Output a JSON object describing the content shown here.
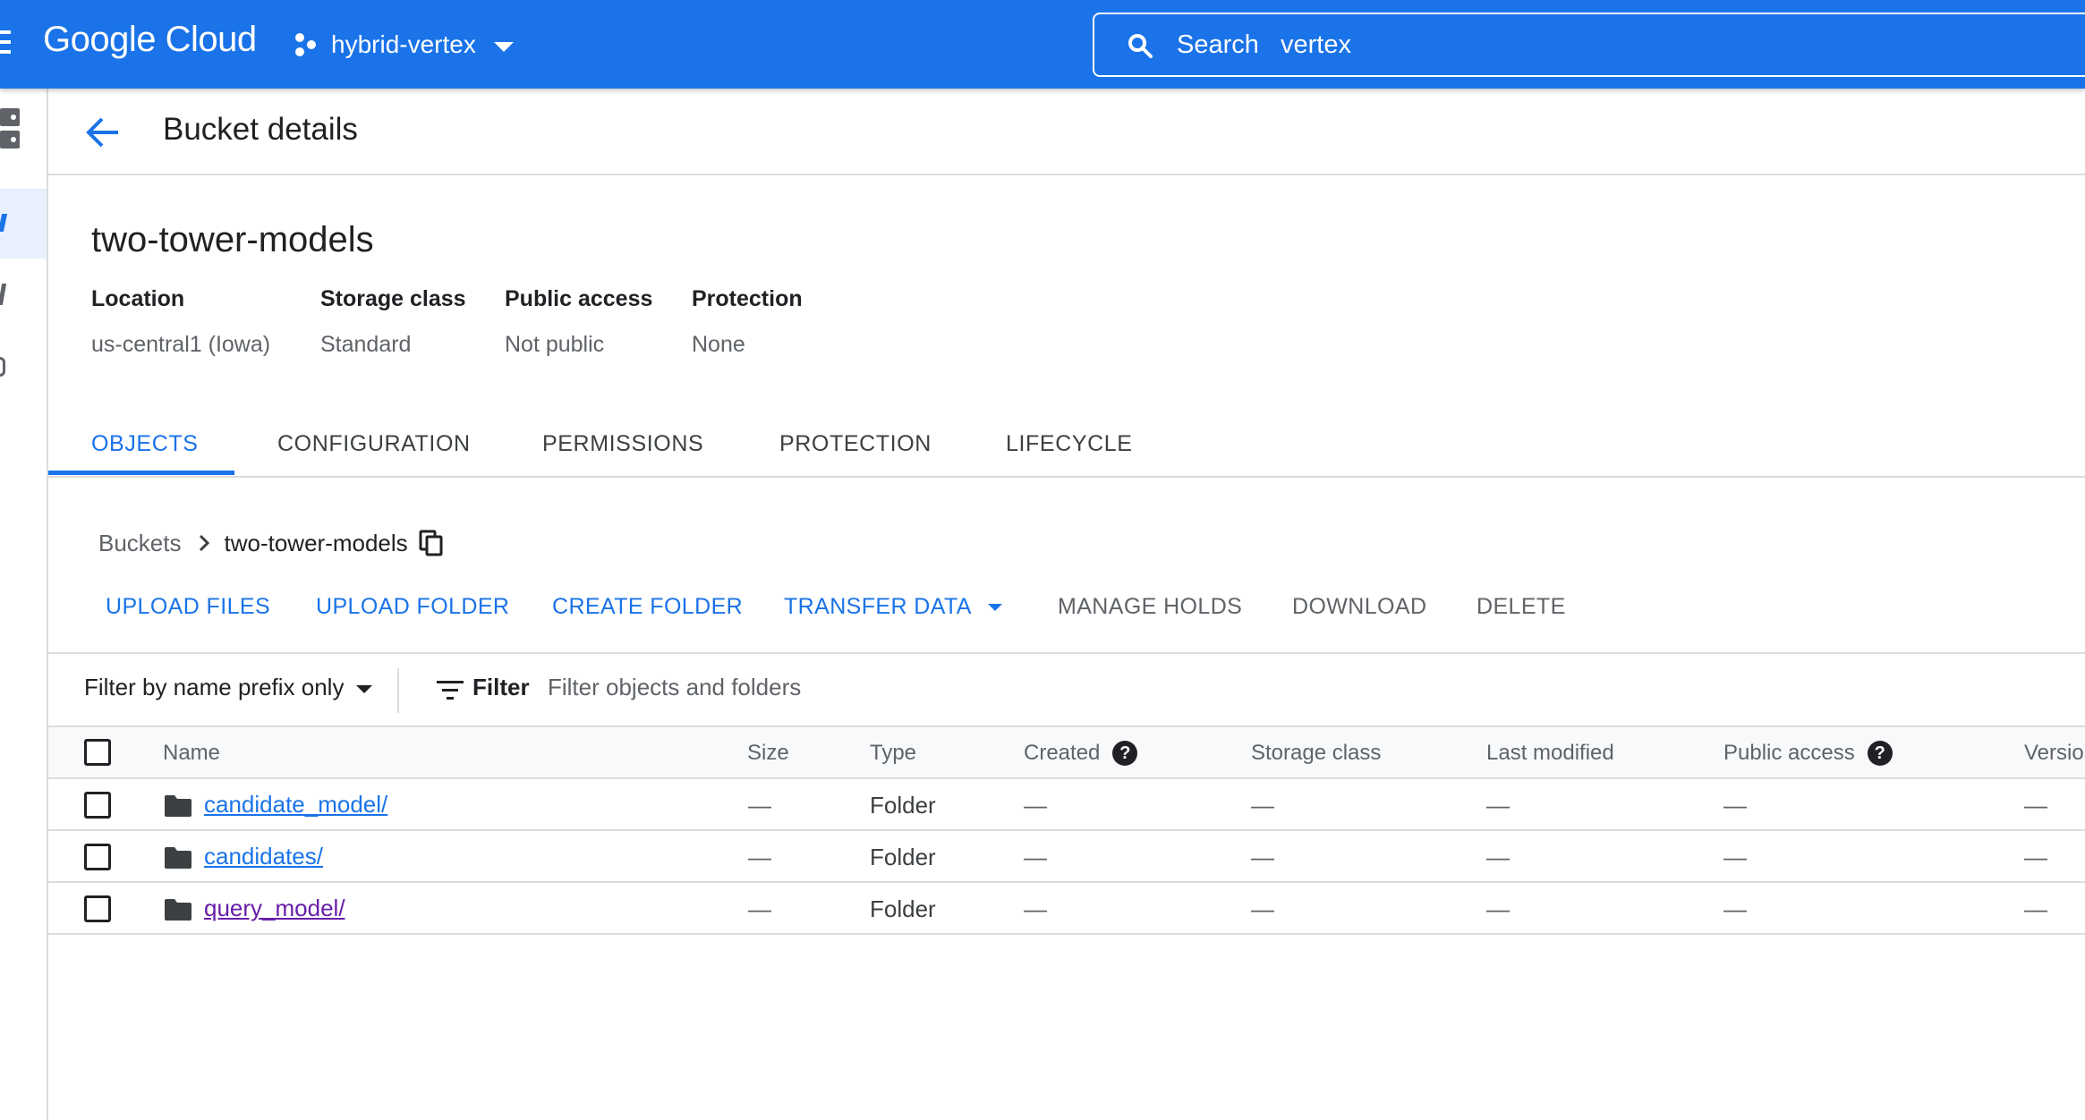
{
  "topbar": {
    "logo": "Google Cloud",
    "project": "hybrid-vertex",
    "search_label": "Search",
    "search_value": "vertex"
  },
  "page": {
    "title": "Bucket details",
    "bucket_name": "two-tower-models"
  },
  "bucket_meta": [
    {
      "label": "Location",
      "value": "us-central1 (Iowa)"
    },
    {
      "label": "Storage class",
      "value": "Standard"
    },
    {
      "label": "Public access",
      "value": "Not public"
    },
    {
      "label": "Protection",
      "value": "None"
    }
  ],
  "tabs": [
    {
      "label": "OBJECTS",
      "active": true
    },
    {
      "label": "CONFIGURATION",
      "active": false
    },
    {
      "label": "PERMISSIONS",
      "active": false
    },
    {
      "label": "PROTECTION",
      "active": false
    },
    {
      "label": "LIFECYCLE",
      "active": false
    }
  ],
  "breadcrumb": {
    "root": "Buckets",
    "current": "two-tower-models"
  },
  "actions": [
    {
      "label": "UPLOAD FILES",
      "enabled": true
    },
    {
      "label": "UPLOAD FOLDER",
      "enabled": true
    },
    {
      "label": "CREATE FOLDER",
      "enabled": true
    },
    {
      "label": "TRANSFER DATA",
      "enabled": true
    },
    {
      "label": "MANAGE HOLDS",
      "enabled": false
    },
    {
      "label": "DOWNLOAD",
      "enabled": false
    },
    {
      "label": "DELETE",
      "enabled": false
    }
  ],
  "filter": {
    "prefix_label": "Filter by name prefix only",
    "filter_label": "Filter",
    "placeholder": "Filter objects and folders"
  },
  "table": {
    "columns": [
      "Name",
      "Size",
      "Type",
      "Created",
      "Storage class",
      "Last modified",
      "Public access",
      "Versio"
    ],
    "rows": [
      {
        "name": "candidate_model/",
        "size": "—",
        "type": "Folder",
        "created": "—",
        "storage_class": "—",
        "last_modified": "—",
        "public_access": "—",
        "version": "—"
      },
      {
        "name": "candidates/",
        "size": "—",
        "type": "Folder",
        "created": "—",
        "storage_class": "—",
        "last_modified": "—",
        "public_access": "—",
        "version": "—"
      },
      {
        "name": "query_model/",
        "size": "—",
        "type": "Folder",
        "created": "—",
        "storage_class": "—",
        "last_modified": "—",
        "public_access": "—",
        "version": "—"
      }
    ]
  },
  "colors": {
    "brand_blue": "#1a73e8",
    "visited_link": "#681da8",
    "divider": "#dadce0"
  }
}
